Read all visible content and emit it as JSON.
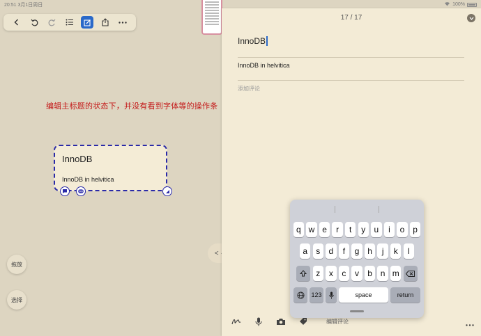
{
  "status": {
    "time_date": "20:51  3月1日周日",
    "battery_text": "100%"
  },
  "toolbar": {
    "buttons": [
      "back-icon",
      "undo-icon",
      "redo-icon",
      "outline-icon",
      "edit-icon",
      "share-icon",
      "more-icon"
    ]
  },
  "annotation": "编辑主标题的状态下，并没有看到字体等的操作条",
  "node": {
    "title": "InnoDB",
    "body": "InnoDB in helvitica"
  },
  "left_buttons": {
    "drag": "拖放",
    "select": "选择"
  },
  "divider_label": "< · >",
  "panel": {
    "page_count": "17 / 17",
    "title_value": "InnoDB",
    "note_text": "InnoDB in helvitica",
    "comment_placeholder": "添加评论",
    "bottom_label": "编辑评论"
  },
  "keyboard": {
    "row1": [
      "q",
      "w",
      "e",
      "r",
      "t",
      "y",
      "u",
      "i",
      "o",
      "p"
    ],
    "row2": [
      "a",
      "s",
      "d",
      "f",
      "g",
      "h",
      "j",
      "k",
      "l"
    ],
    "row3": [
      "z",
      "x",
      "c",
      "v",
      "b",
      "n",
      "m"
    ],
    "numbers_key": "123",
    "space_key": "space",
    "return_key": "return"
  },
  "colors": {
    "accent": "#2a69c9",
    "node_border": "#2a2aa8",
    "annotation": "#c41919"
  }
}
